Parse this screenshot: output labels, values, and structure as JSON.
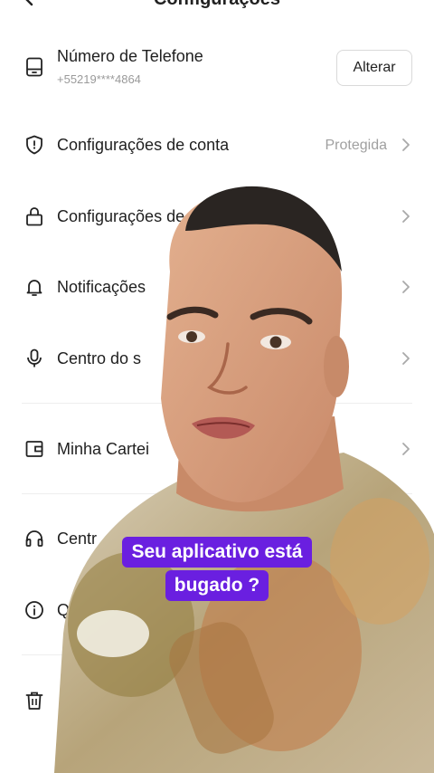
{
  "header": {
    "title": "Configurações"
  },
  "rows": [
    {
      "label": "Número de Telefone",
      "sub": "+55219****4864",
      "button": "Alterar",
      "icon": "phone-icon"
    },
    {
      "label": "Configurações de conta",
      "status": "Protegida",
      "icon": "shield-icon"
    },
    {
      "label": "Configurações de",
      "icon": "lock-icon"
    },
    {
      "label": "Notificações",
      "icon": "bell-icon"
    },
    {
      "label": "Centro do s",
      "icon": "microphone-icon"
    },
    {
      "label": "Minha Cartei",
      "icon": "wallet-icon"
    },
    {
      "label": "Centr",
      "icon": "headset-icon"
    },
    {
      "label": "Qu",
      "icon": "info-icon"
    },
    {
      "label": "",
      "icon": "trash-icon"
    }
  ],
  "overlay": {
    "caption_line1": "Seu aplicativo está",
    "caption_line2": "bugado ?"
  },
  "colors": {
    "caption_bg": "#6a1fe0",
    "text": "#1f1f1f",
    "muted": "#9a9a9a"
  }
}
